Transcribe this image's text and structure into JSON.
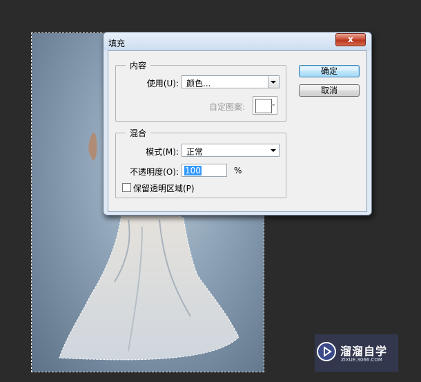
{
  "dialog": {
    "title": "填充",
    "close_label": "x",
    "ok_label": "确定",
    "cancel_label": "取消"
  },
  "content_group": {
    "title": "内容",
    "use_label": "使用(U):",
    "use_value": "颜色...",
    "pattern_label": "自定图案:"
  },
  "blend_group": {
    "title": "混合",
    "mode_label": "模式(M):",
    "mode_value": "正常",
    "opacity_label": "不透明度(O):",
    "opacity_value": "100",
    "opacity_unit": "%",
    "preserve_label": "保留透明区域(P)",
    "preserve_checked": false
  },
  "watermark": {
    "logo_text": "溜溜自学",
    "url": "ZIXUE.3066.COM"
  }
}
